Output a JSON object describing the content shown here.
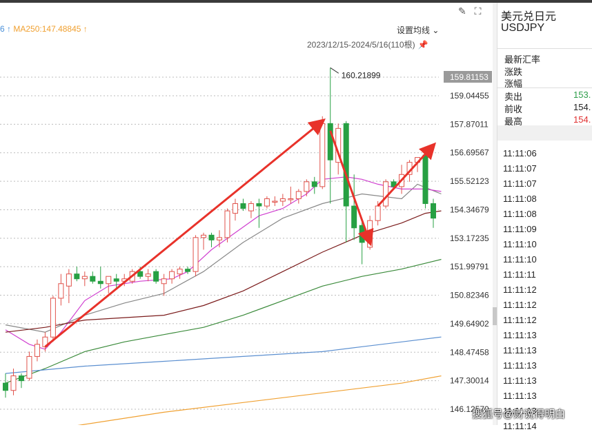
{
  "header": {
    "ma_left_fragment": "6 ↑",
    "ma250_label": "MA250:147.48845 ↑",
    "settings_label": "设置均线",
    "settings_chevron": "⌄",
    "date_range": "2023/12/15-2024/5/16(110根)",
    "edit_icon": "✎",
    "fullscreen_icon": "⛶"
  },
  "right_panel": {
    "title": "美元兑日元",
    "code": "USDJPY",
    "labels": {
      "latest": "最新汇率",
      "change": "涨跌",
      "change_pct": "涨幅"
    },
    "quotes": [
      {
        "label": "卖出",
        "value": "153.",
        "color": "#2e9e4a"
      },
      {
        "label": "前收",
        "value": "154.",
        "color": "#222222"
      },
      {
        "label": "最高",
        "value": "154.",
        "color": "#e03030"
      }
    ],
    "times": [
      "11:11:06",
      "11:11:07",
      "11:11:07",
      "11:11:08",
      "11:11:08",
      "11:11:09",
      "11:11:10",
      "11:11:10",
      "11:11:11",
      "11:11:12",
      "11:11:12",
      "11:11:12",
      "11:11:13",
      "11:11:13",
      "11:11:13",
      "11:11:13",
      "11:11:13",
      "11:11:13",
      "11:11:14"
    ]
  },
  "watermark": "搜狐号@财说得明白",
  "chart_data": {
    "type": "candlestick",
    "y_ticks": [
      "159.81153",
      "159.04455",
      "157.87011",
      "156.69567",
      "155.52123",
      "154.34679",
      "153.17235",
      "151.99791",
      "150.82346",
      "149.64902",
      "148.47458",
      "147.30014",
      "146.12570"
    ],
    "ylim": [
      146.0,
      160.6
    ],
    "highlighted_tick": "159.81153",
    "annotation": "160.21899",
    "colors": {
      "up": "#e0514a",
      "down": "#27a043",
      "arrow": "#e8322a"
    },
    "candles": [
      {
        "o": 147.2,
        "h": 147.6,
        "l": 146.6,
        "c": 146.9
      },
      {
        "o": 146.9,
        "h": 147.8,
        "l": 146.7,
        "c": 147.5
      },
      {
        "o": 147.5,
        "h": 147.6,
        "l": 147.0,
        "c": 147.3
      },
      {
        "o": 147.4,
        "h": 148.5,
        "l": 147.3,
        "c": 148.3
      },
      {
        "o": 148.3,
        "h": 149.0,
        "l": 148.1,
        "c": 148.8
      },
      {
        "o": 148.7,
        "h": 149.3,
        "l": 148.5,
        "c": 149.1
      },
      {
        "o": 149.1,
        "h": 150.8,
        "l": 148.9,
        "c": 150.7
      },
      {
        "o": 150.7,
        "h": 151.7,
        "l": 150.4,
        "c": 151.3
      },
      {
        "o": 151.2,
        "h": 151.9,
        "l": 150.5,
        "c": 151.7
      },
      {
        "o": 151.7,
        "h": 152.0,
        "l": 151.4,
        "c": 151.5
      },
      {
        "o": 151.5,
        "h": 151.8,
        "l": 151.2,
        "c": 151.6
      },
      {
        "o": 151.6,
        "h": 151.8,
        "l": 151.3,
        "c": 151.4
      },
      {
        "o": 151.4,
        "h": 152.0,
        "l": 151.1,
        "c": 151.3
      },
      {
        "o": 151.3,
        "h": 151.6,
        "l": 150.9,
        "c": 151.6
      },
      {
        "o": 151.5,
        "h": 151.7,
        "l": 151.1,
        "c": 151.4
      },
      {
        "o": 151.4,
        "h": 151.7,
        "l": 151.2,
        "c": 151.5
      },
      {
        "o": 151.4,
        "h": 151.9,
        "l": 151.3,
        "c": 151.8
      },
      {
        "o": 151.8,
        "h": 152.0,
        "l": 151.5,
        "c": 151.6
      },
      {
        "o": 151.6,
        "h": 151.9,
        "l": 151.4,
        "c": 151.7
      },
      {
        "o": 151.8,
        "h": 151.9,
        "l": 151.3,
        "c": 151.4
      },
      {
        "o": 151.3,
        "h": 151.7,
        "l": 150.8,
        "c": 151.5
      },
      {
        "o": 151.5,
        "h": 151.9,
        "l": 151.3,
        "c": 151.8
      },
      {
        "o": 151.7,
        "h": 152.0,
        "l": 151.5,
        "c": 151.9
      },
      {
        "o": 151.9,
        "h": 152.0,
        "l": 151.7,
        "c": 151.8
      },
      {
        "o": 151.8,
        "h": 153.3,
        "l": 151.6,
        "c": 153.2
      },
      {
        "o": 153.2,
        "h": 153.4,
        "l": 152.7,
        "c": 153.3
      },
      {
        "o": 153.3,
        "h": 153.4,
        "l": 152.8,
        "c": 153.1
      },
      {
        "o": 153.1,
        "h": 153.5,
        "l": 152.8,
        "c": 153.2
      },
      {
        "o": 153.2,
        "h": 154.4,
        "l": 153.0,
        "c": 154.3
      },
      {
        "o": 154.2,
        "h": 154.8,
        "l": 153.9,
        "c": 154.6
      },
      {
        "o": 154.6,
        "h": 154.8,
        "l": 154.3,
        "c": 154.4
      },
      {
        "o": 154.3,
        "h": 154.7,
        "l": 154.0,
        "c": 154.6
      },
      {
        "o": 154.6,
        "h": 154.8,
        "l": 153.6,
        "c": 154.5
      },
      {
        "o": 154.5,
        "h": 154.9,
        "l": 154.4,
        "c": 154.8
      },
      {
        "o": 154.7,
        "h": 154.9,
        "l": 154.5,
        "c": 154.7
      },
      {
        "o": 154.7,
        "h": 155.0,
        "l": 154.5,
        "c": 154.8
      },
      {
        "o": 154.8,
        "h": 155.3,
        "l": 154.6,
        "c": 154.8
      },
      {
        "o": 154.8,
        "h": 155.2,
        "l": 154.6,
        "c": 155.1
      },
      {
        "o": 155.1,
        "h": 155.6,
        "l": 154.9,
        "c": 155.5
      },
      {
        "o": 155.5,
        "h": 155.7,
        "l": 155.0,
        "c": 155.3
      },
      {
        "o": 155.3,
        "h": 158.2,
        "l": 155.2,
        "c": 157.9
      },
      {
        "o": 157.9,
        "h": 160.2,
        "l": 154.6,
        "c": 156.4
      },
      {
        "o": 156.3,
        "h": 157.9,
        "l": 155.8,
        "c": 157.7
      },
      {
        "o": 157.9,
        "h": 158.0,
        "l": 153.0,
        "c": 154.5
      },
      {
        "o": 154.5,
        "h": 155.8,
        "l": 153.1,
        "c": 153.6
      },
      {
        "o": 153.7,
        "h": 153.9,
        "l": 152.1,
        "c": 153.0
      },
      {
        "o": 152.8,
        "h": 154.1,
        "l": 152.7,
        "c": 153.9
      },
      {
        "o": 153.9,
        "h": 154.7,
        "l": 153.7,
        "c": 154.5
      },
      {
        "o": 154.5,
        "h": 155.6,
        "l": 154.4,
        "c": 155.5
      },
      {
        "o": 155.5,
        "h": 155.6,
        "l": 155.2,
        "c": 155.3
      },
      {
        "o": 155.3,
        "h": 156.2,
        "l": 155.0,
        "c": 155.8
      },
      {
        "o": 155.8,
        "h": 156.4,
        "l": 155.5,
        "c": 156.3
      },
      {
        "o": 156.3,
        "h": 156.5,
        "l": 155.9,
        "c": 156.5
      },
      {
        "o": 156.6,
        "h": 156.6,
        "l": 154.4,
        "c": 154.6
      },
      {
        "o": 154.6,
        "h": 154.8,
        "l": 153.6,
        "c": 154.0
      }
    ],
    "moving_averages": [
      {
        "color": "#888888",
        "points": [
          [
            0,
            149.6
          ],
          [
            5,
            149.3
          ],
          [
            10,
            150.0
          ],
          [
            15,
            150.5
          ],
          [
            20,
            150.9
          ],
          [
            25,
            151.8
          ],
          [
            30,
            153.0
          ],
          [
            35,
            154.0
          ],
          [
            40,
            154.6
          ],
          [
            45,
            155.0
          ],
          [
            50,
            154.8
          ],
          [
            52,
            155.4
          ],
          [
            55,
            155.0
          ]
        ]
      },
      {
        "color": "#d040d0",
        "points": [
          [
            0,
            149.4
          ],
          [
            3,
            148.8
          ],
          [
            5,
            148.6
          ],
          [
            7,
            149.3
          ],
          [
            10,
            150.6
          ],
          [
            13,
            151.2
          ],
          [
            17,
            151.4
          ],
          [
            21,
            151.5
          ],
          [
            23,
            151.8
          ],
          [
            26,
            152.7
          ],
          [
            29,
            153.4
          ],
          [
            32,
            154.1
          ],
          [
            35,
            154.4
          ],
          [
            38,
            155.0
          ],
          [
            40,
            155.6
          ],
          [
            43,
            155.7
          ],
          [
            45,
            155.6
          ],
          [
            47,
            155.4
          ],
          [
            50,
            155.2
          ],
          [
            53,
            155.2
          ],
          [
            55,
            155.1
          ]
        ]
      },
      {
        "color": "#7a1a1a",
        "points": [
          [
            0,
            149.3
          ],
          [
            5,
            149.5
          ],
          [
            10,
            149.8
          ],
          [
            15,
            149.9
          ],
          [
            20,
            150.0
          ],
          [
            25,
            150.4
          ],
          [
            30,
            151.0
          ],
          [
            35,
            151.8
          ],
          [
            40,
            152.6
          ],
          [
            45,
            153.3
          ],
          [
            50,
            153.8
          ],
          [
            53,
            154.2
          ],
          [
            55,
            154.3
          ]
        ]
      },
      {
        "color": "#3a8a3a",
        "points": [
          [
            0,
            147.2
          ],
          [
            5,
            147.8
          ],
          [
            10,
            148.5
          ],
          [
            15,
            148.9
          ],
          [
            20,
            149.2
          ],
          [
            25,
            149.5
          ],
          [
            30,
            150.0
          ],
          [
            35,
            150.6
          ],
          [
            40,
            151.2
          ],
          [
            45,
            151.6
          ],
          [
            50,
            151.9
          ],
          [
            55,
            152.3
          ]
        ]
      },
      {
        "color": "#5b8fd0",
        "points": [
          [
            0,
            147.6
          ],
          [
            10,
            147.9
          ],
          [
            20,
            148.1
          ],
          [
            30,
            148.3
          ],
          [
            40,
            148.5
          ],
          [
            45,
            148.7
          ],
          [
            50,
            148.9
          ],
          [
            55,
            149.1
          ]
        ]
      },
      {
        "color": "#f0a030",
        "points": [
          [
            0,
            145.0
          ],
          [
            10,
            145.5
          ],
          [
            20,
            146.0
          ],
          [
            30,
            146.4
          ],
          [
            40,
            146.8
          ],
          [
            50,
            147.2
          ],
          [
            55,
            147.5
          ]
        ]
      }
    ],
    "arrows": [
      {
        "from": [
          5,
          148.7
        ],
        "to": [
          40,
          158.0
        ]
      },
      {
        "from": [
          41,
          157.6
        ],
        "to": [
          46,
          153.0
        ]
      },
      {
        "from": [
          47,
          154.5
        ],
        "to": [
          54,
          157.0
        ]
      }
    ]
  }
}
